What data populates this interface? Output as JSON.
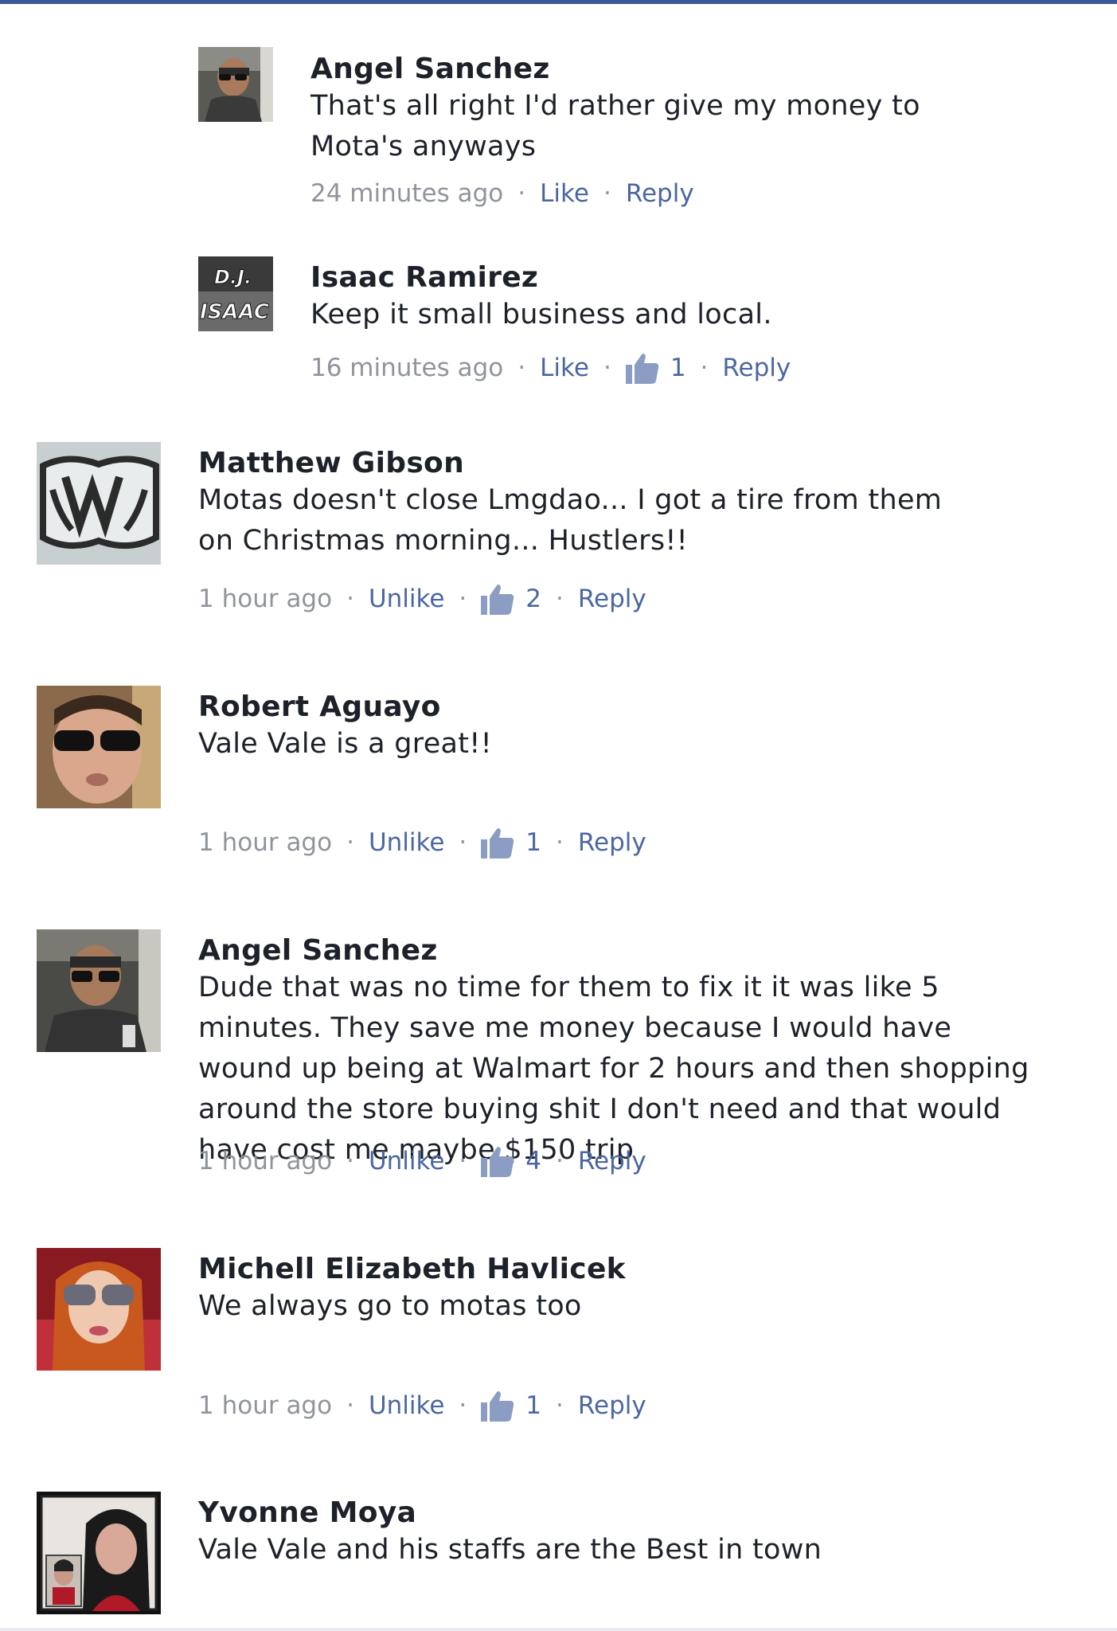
{
  "accent": "#3b5998",
  "link_color": "#4b67a1",
  "comments": [
    {
      "author": "Angel Sanchez",
      "text": "That's all right I'd rather give my money to Mota's anyways",
      "time": "24 minutes ago",
      "action": "Like",
      "likes": "",
      "reply": "Reply",
      "avatar_icon": "profile-photo"
    },
    {
      "author": "Isaac Ramirez",
      "text": "Keep it small business and local.",
      "time": "16 minutes ago",
      "action": "Like",
      "likes": "1",
      "reply": "Reply",
      "avatar_icon": "dj-logo",
      "avatar_text_1": "D.J.",
      "avatar_text_2": "ISAAC"
    },
    {
      "author": "Matthew Gibson",
      "text": "Motas doesn't close Lmgdao... I got a tire from them on Christmas morning... Hustlers!!",
      "time": "1 hour ago",
      "action": "Unlike",
      "likes": "2",
      "reply": "Reply",
      "avatar_icon": "graphic-logo"
    },
    {
      "author": "Robert Aguayo",
      "text": "Vale Vale is a great!!",
      "time": "1 hour ago",
      "action": "Unlike",
      "likes": "1",
      "reply": "Reply",
      "avatar_icon": "profile-photo"
    },
    {
      "author": "Angel Sanchez",
      "text": "Dude that was no time for them to fix it it was like 5 minutes. They save me money because I would have wound up being at Walmart for 2 hours and then shopping around the store buying shit I don't need and that would have cost me maybe $150 trip",
      "time": "1 hour ago",
      "action": "Unlike",
      "likes": "4",
      "reply": "Reply",
      "avatar_icon": "profile-photo"
    },
    {
      "author": "Michell Elizabeth Havlicek",
      "text": "We always go to motas too",
      "time": "1 hour ago",
      "action": "Unlike",
      "likes": "1",
      "reply": "Reply",
      "avatar_icon": "profile-photo"
    },
    {
      "author": "Yvonne Moya",
      "text": "Vale Vale and his staffs are the Best in town",
      "time": "",
      "action": "",
      "likes": "",
      "reply": "",
      "avatar_icon": "profile-photo"
    }
  ]
}
